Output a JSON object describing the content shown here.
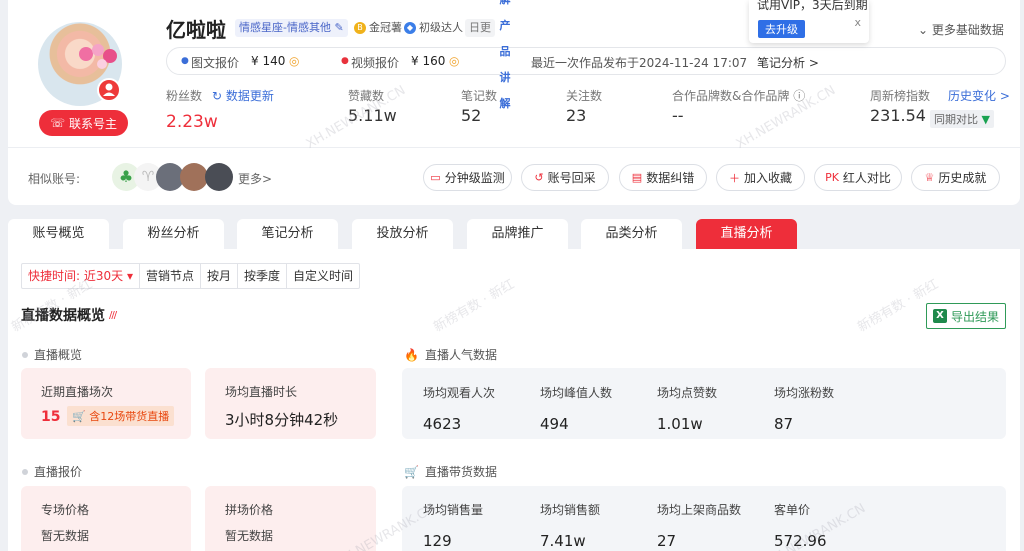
{
  "profile": {
    "name": "亿啦啦",
    "category_tag": "情感星座-情感其他",
    "crown_tag": "金冠薯",
    "level_tag": "初级达人",
    "update_tag": "日更",
    "contact_label": "联系号主"
  },
  "prices": {
    "image_label": "图文报价",
    "image_value": "¥ 140",
    "video_label": "视频报价",
    "video_value": "¥ 160",
    "latest_post": "最近一次作品发布于2024-11-24 17:07",
    "note_analysis": "笔记分析 >"
  },
  "vertical_menu": [
    "解",
    "产",
    "品",
    "讲",
    "解"
  ],
  "vip_popup": {
    "text": "试用VIP，3天后到期",
    "button": "去升级",
    "close": "x"
  },
  "more_base_data": "更多基础数据",
  "stats": {
    "fans_label": "粉丝数",
    "refresh_label": "数据更新",
    "fans_value": "2.23w",
    "likes_label": "赞藏数",
    "likes_value": "5.11w",
    "notes_label": "笔记数",
    "notes_value": "52",
    "follow_label": "关注数",
    "follow_value": "23",
    "brand_label": "合作品牌数&合作品牌",
    "brand_value": "--",
    "index_label": "周新榜指数",
    "history_link": "历史变化 >",
    "index_value": "231.54",
    "week_compare": "同期对比"
  },
  "similar": {
    "label": "相似账号:",
    "more": "更多>"
  },
  "actions": [
    "分钟级监测",
    "账号回采",
    "数据纠错",
    "加入收藏",
    "红人对比",
    "历史成就"
  ],
  "tabs": [
    "账号概览",
    "粉丝分析",
    "笔记分析",
    "投放分析",
    "品牌推广",
    "品类分析",
    "直播分析"
  ],
  "time_filter": [
    "快捷时间: 近30天 ▾",
    "营销节点",
    "按月",
    "按季度",
    "自定义时间"
  ],
  "live_overview": {
    "title": "直播数据概览",
    "export": "导出结果",
    "overview_label": "直播概览",
    "recent_sessions_label": "近期直播场次",
    "recent_sessions_value": "15",
    "goods_sessions": "含12场带货直播",
    "avg_duration_label": "场均直播时长",
    "avg_duration_value": "3小时8分钟42秒",
    "popularity_label": "直播人气数据",
    "popularity": [
      {
        "label": "场均观看人次",
        "value": "4623"
      },
      {
        "label": "场均峰值人数",
        "value": "494"
      },
      {
        "label": "场均点赞数",
        "value": "1.01w"
      },
      {
        "label": "场均涨粉数",
        "value": "87"
      }
    ],
    "price_label": "直播报价",
    "special_price_label": "专场价格",
    "special_price_value": "暂无数据",
    "combined_price_label": "拼场价格",
    "combined_price_value": "暂无数据",
    "sales_label": "直播带货数据",
    "sales": [
      {
        "label": "场均销售量",
        "value": "129"
      },
      {
        "label": "场均销售额",
        "value": "7.41w"
      },
      {
        "label": "场均上架商品数",
        "value": "27"
      },
      {
        "label": "客单价",
        "value": "572.96"
      }
    ]
  },
  "watermarks": [
    "XH.NEWRANK.CN",
    "新榜有数 · 新红"
  ]
}
